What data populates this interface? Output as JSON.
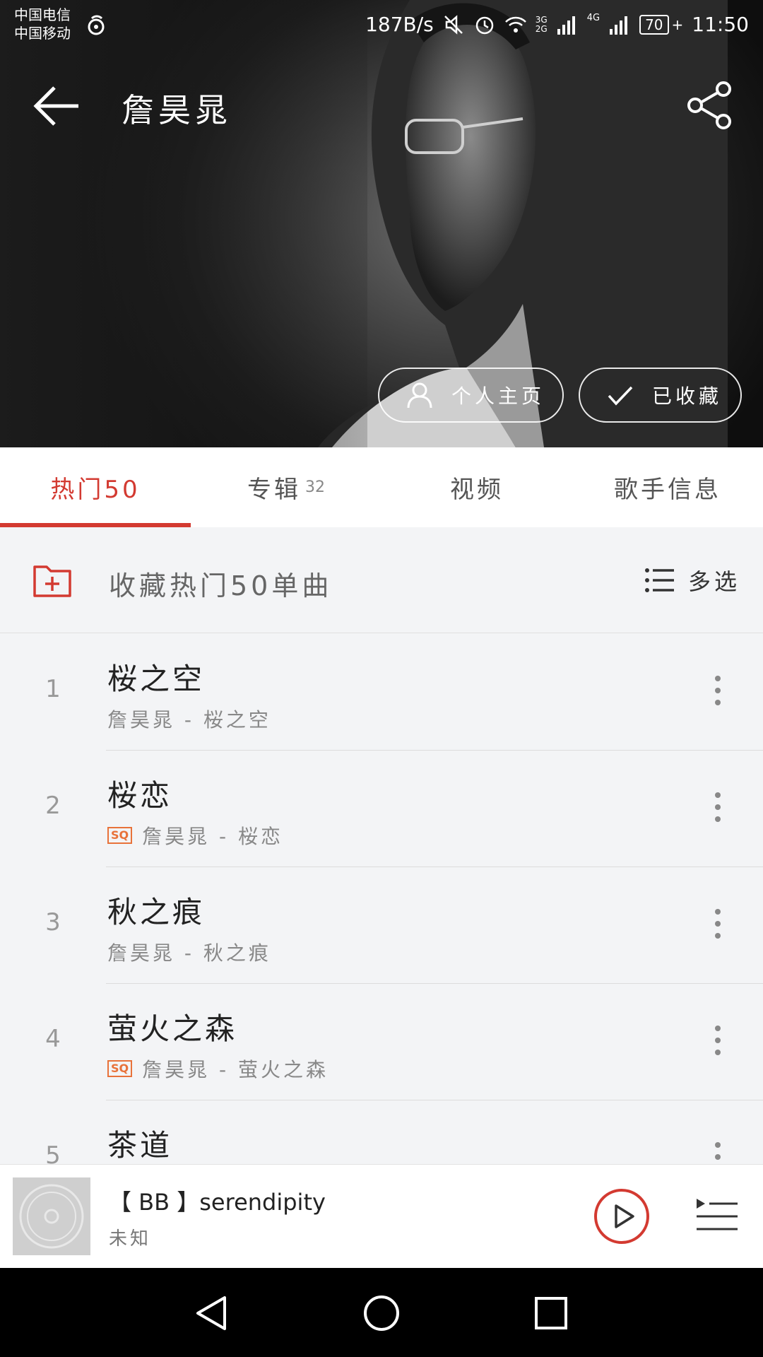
{
  "status_bar": {
    "carrier_1": "中国电信",
    "carrier_2": "中国移动",
    "net_speed": "187B/s",
    "network_3g": "3G",
    "network_2g": "2G",
    "network_4g": "4G",
    "battery": "70",
    "time": "11:50"
  },
  "header": {
    "artist_name": "詹昊晁",
    "profile_button": "个人主页",
    "favorited_button": "已收藏"
  },
  "tabs": [
    {
      "label": "热门50",
      "count": ""
    },
    {
      "label": "专辑",
      "count": "32"
    },
    {
      "label": "视频",
      "count": ""
    },
    {
      "label": "歌手信息",
      "count": ""
    }
  ],
  "collect_row": {
    "label": "收藏热门50单曲",
    "multi_select": "多选"
  },
  "songs": [
    {
      "num": "1",
      "title": "桜之空",
      "sq": "",
      "subtitle": "詹昊晁 - 桜之空"
    },
    {
      "num": "2",
      "title": "桜恋",
      "sq": "SQ",
      "subtitle": "詹昊晁 - 桜恋"
    },
    {
      "num": "3",
      "title": "秋之痕",
      "sq": "",
      "subtitle": "詹昊晁 - 秋之痕"
    },
    {
      "num": "4",
      "title": "萤火之森",
      "sq": "SQ",
      "subtitle": "詹昊晁 - 萤火之森"
    },
    {
      "num": "5",
      "title": "茶道",
      "sq": "",
      "subtitle": ""
    }
  ],
  "now_playing": {
    "title": "【 BB 】serendipity",
    "artist": "未知"
  },
  "colors": {
    "accent": "#d33a31",
    "sq_badge": "#e8723a"
  },
  "icons": {
    "back": "arrow-left-icon",
    "share": "share-icon",
    "profile": "person-icon",
    "favorited": "check-icon",
    "collect": "folder-plus-icon",
    "multi_select": "list-icon",
    "more": "vertical-dots-icon",
    "play": "play-icon",
    "playlist": "playlist-icon"
  }
}
